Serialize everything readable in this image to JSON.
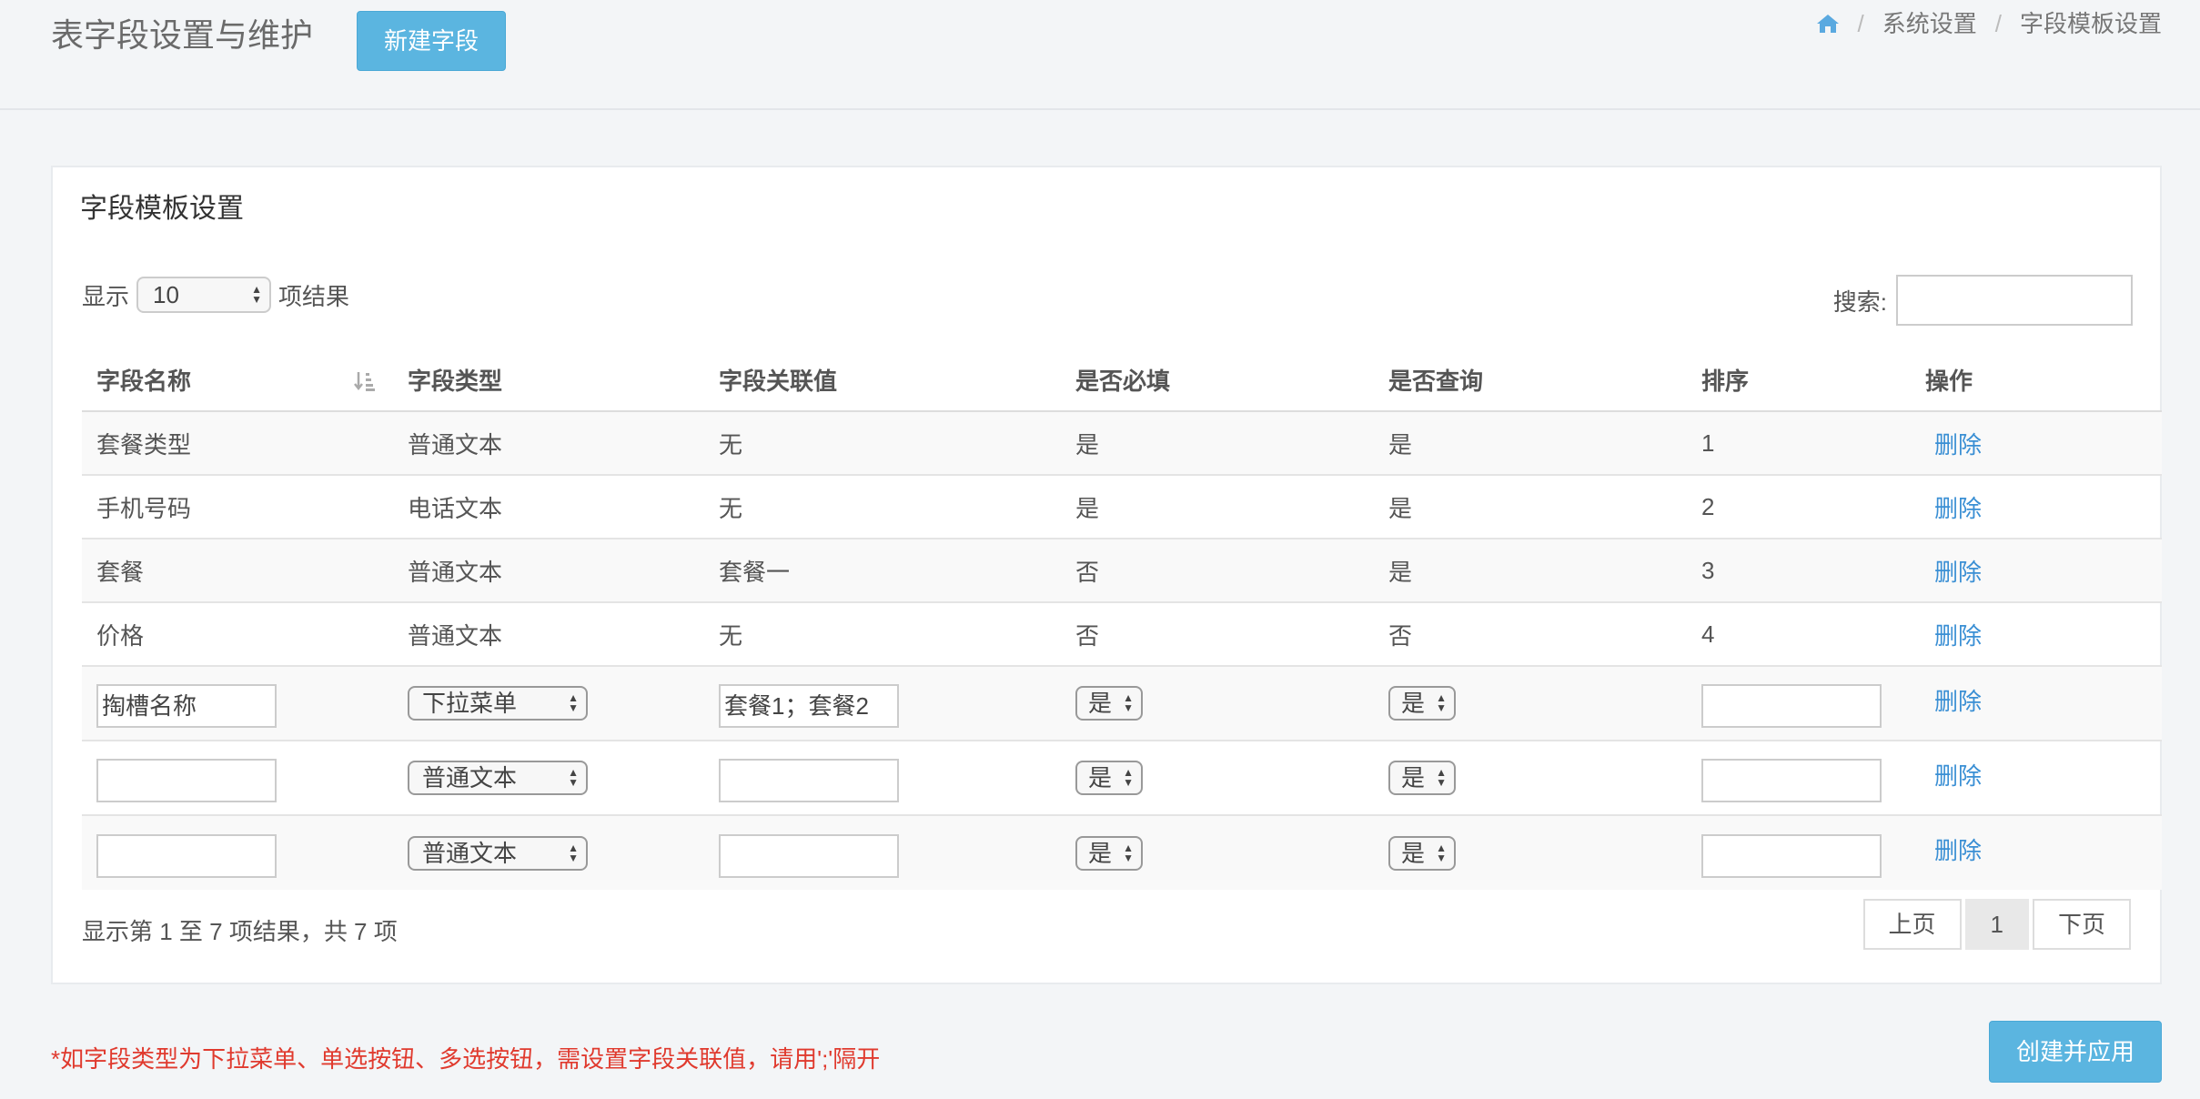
{
  "header": {
    "title": "表字段设置与维护",
    "new_button": "新建字段",
    "breadcrumb": [
      "系统设置",
      "字段模板设置"
    ]
  },
  "panel": {
    "title": "字段模板设置",
    "length_prefix": "显示",
    "length_value": "10",
    "length_suffix": "项结果",
    "search_label": "搜索:",
    "columns": [
      "字段名称",
      "字段类型",
      "字段关联值",
      "是否必填",
      "是否查询",
      "排序",
      "操作"
    ],
    "rows": [
      {
        "name": "套餐类型",
        "type": "普通文本",
        "value": "无",
        "required": "是",
        "query": "是",
        "order": "1",
        "action": "删除"
      },
      {
        "name": "手机号码",
        "type": "电话文本",
        "value": "无",
        "required": "是",
        "query": "是",
        "order": "2",
        "action": "删除"
      },
      {
        "name": "套餐",
        "type": "普通文本",
        "value": "套餐一",
        "required": "否",
        "query": "是",
        "order": "3",
        "action": "删除"
      },
      {
        "name": "价格",
        "type": "普通文本",
        "value": "无",
        "required": "否",
        "query": "否",
        "order": "4",
        "action": "删除"
      }
    ],
    "edit_rows": [
      {
        "name": "掏槽名称",
        "type": "下拉菜单",
        "value": "套餐1；套餐2",
        "required": "是",
        "query": "是",
        "order": "",
        "action": "删除"
      },
      {
        "name": "",
        "type": "普通文本",
        "value": "",
        "required": "是",
        "query": "是",
        "order": "",
        "action": "删除"
      },
      {
        "name": "",
        "type": "普通文本",
        "value": "",
        "required": "是",
        "query": "是",
        "order": "",
        "action": "删除"
      }
    ],
    "info": "显示第 1 至 7 项结果，共 7 项",
    "pager": {
      "prev": "上页",
      "current": "1",
      "next": "下页"
    }
  },
  "footer": {
    "note": "*如字段类型为下拉菜单、单选按钮、多选按钮，需设置字段关联值，请用';'隔开",
    "apply_button": "创建并应用"
  },
  "colors": {
    "accent": "#5bb5e0",
    "link": "#3a8fd4",
    "warning": "#e03a2e"
  }
}
